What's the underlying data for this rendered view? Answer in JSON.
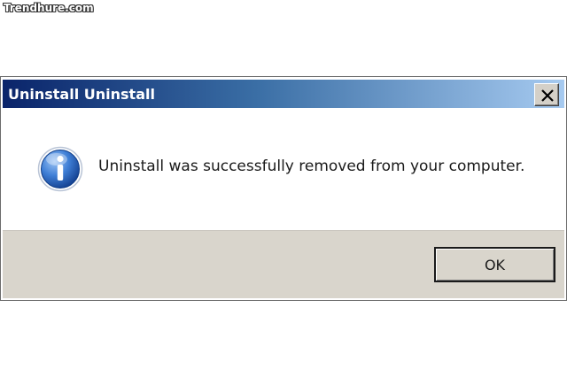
{
  "watermark": {
    "text": "Trendhure.com"
  },
  "dialog": {
    "title": "Uninstall Uninstall",
    "icon": "info-icon",
    "message": "Uninstall was successfully removed from your computer.",
    "ok_label": "OK",
    "close_label": "✕"
  },
  "colors": {
    "titlebar_start": "#0a246a",
    "titlebar_end": "#a6caf0",
    "footer_bg": "#d9d5cc",
    "icon_blue": "#2a5fb0"
  }
}
